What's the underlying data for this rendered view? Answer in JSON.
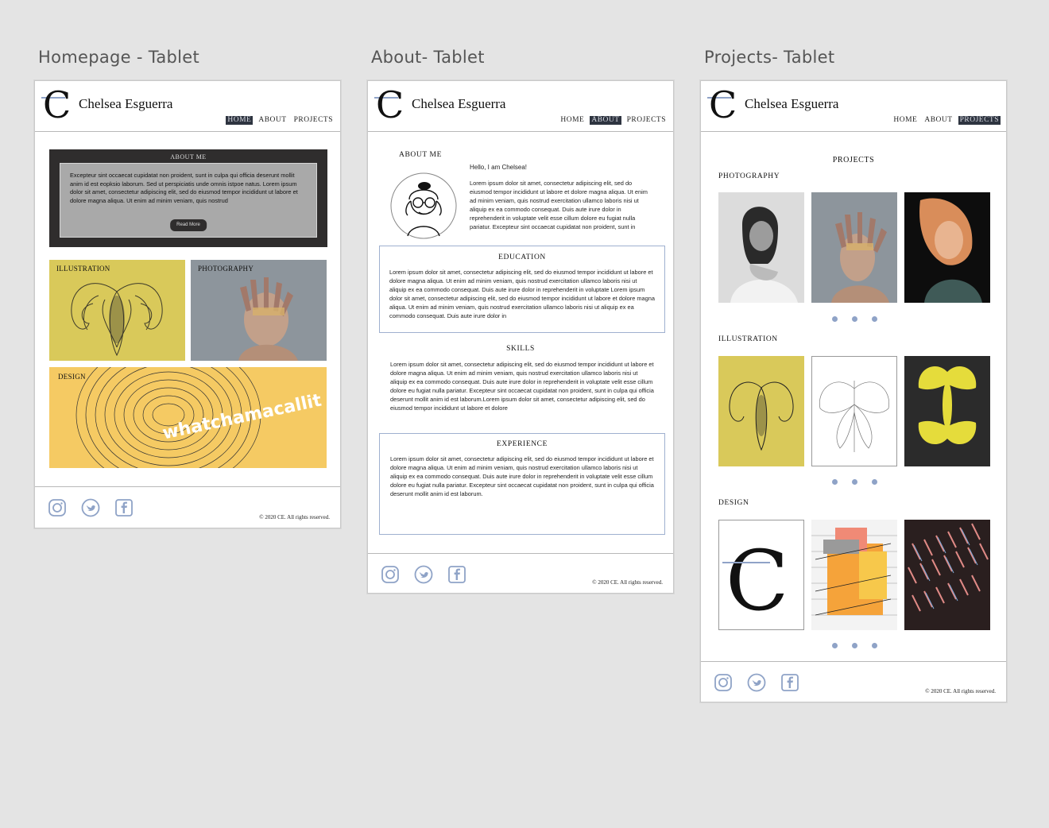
{
  "artboards": {
    "home": "Homepage - Tablet",
    "about": "About- Tablet",
    "projects": "Projects- Tablet"
  },
  "brand": {
    "logo_letter": "C",
    "name": "Chelsea Esguerra"
  },
  "nav": {
    "home": "HOME",
    "about": "ABOUT",
    "projects": "PROJECTS"
  },
  "footer": {
    "copyright": "© 2020 CE. All rights reserved.",
    "icons": [
      "instagram-icon",
      "twitter-icon",
      "facebook-icon"
    ]
  },
  "home": {
    "about_title": "ABOUT ME",
    "about_text": "Excepteur sint occaecat cupidatat non proident, sunt in culpa qui officia deserunt mollit anim id est eopksio laborum. Sed ut perspiciatis unde omnis istpoe natus. Lorem ipsum dolor sit amet, consectetur adipiscing elit, sed do eiusmod tempor incididunt ut labore et dolore magna aliqua. Ut enim ad minim veniam, quis nostrud",
    "read_more": "Read More",
    "tiles": {
      "illustration": "ILLUSTRATION",
      "photography": "PHOTOGRAPHY",
      "design": "DESIGN",
      "design_art_text": "whatchamacallit"
    }
  },
  "about": {
    "title": "ABOUT ME",
    "greeting": "Hello, I am Chelsea!",
    "intro": "Lorem ipsum dolor sit amet, consectetur adipiscing elit, sed do eiusmod tempor incididunt ut labore et dolore magna aliqua. Ut enim ad minim veniam, quis nostrud exercitation ullamco laboris nisi ut aliquip ex ea commodo consequat. Duis aute irure dolor in reprehenderit in voluptate velit esse cillum dolore eu fugiat nulla pariatur. Excepteur sint occaecat cupidatat non proident, sunt in",
    "education_title": "EDUCATION",
    "education": "Lorem ipsum dolor sit amet, consectetur adipiscing elit, sed do eiusmod tempor incididunt ut labore et dolore magna aliqua. Ut enim ad minim veniam, quis nostrud exercitation ullamco laboris nisi ut aliquip ex ea commodo consequat. Duis aute irure dolor in reprehenderit in voluptate Lorem ipsum dolor sit amet, consectetur adipiscing elit, sed do eiusmod tempor incididunt ut labore et dolore magna aliqua. Ut enim ad minim veniam, quis nostrud exercitation ullamco laboris nisi ut aliquip ex ea commodo consequat. Duis aute irure dolor in",
    "skills_title": "SKILLS",
    "skills": "Lorem ipsum dolor sit amet, consectetur adipiscing elit, sed do eiusmod tempor incididunt ut labore et dolore magna aliqua. Ut enim ad minim veniam, quis nostrud exercitation ullamco laboris nisi ut aliquip ex ea commodo consequat. Duis aute irure dolor in reprehenderit in voluptate velit esse cillum dolore eu fugiat nulla pariatur. Excepteur sint occaecat cupidatat non proident, sunt in culpa qui officia deserunt mollit anim id est laborum.Lorem ipsum dolor sit amet, consectetur adipiscing elit, sed do eiusmod tempor incididunt ut labore et dolore",
    "experience_title": "EXPERIENCE",
    "experience": "Lorem ipsum dolor sit amet, consectetur adipiscing elit, sed do eiusmod tempor incididunt ut labore et dolore magna aliqua. Ut enim ad minim veniam, quis nostrud exercitation ullamco laboris nisi ut aliquip ex ea commodo consequat. Duis aute irure dolor in reprehenderit in voluptate velit esse cillum dolore eu fugiat nulla pariatur. Excepteur sint occaecat cupidatat non proident, sunt in culpa qui officia deserunt mollit anim id est laborum."
  },
  "projects": {
    "title": "PROJECTS",
    "photography": "PHOTOGRAPHY",
    "illustration": "ILLUSTRATION",
    "design": "DESIGN"
  },
  "colors": {
    "accent": "#8fa3c7",
    "nav_active": "#2e3440",
    "yellow": "#d9c95a",
    "design_yellow": "#f5ca63"
  }
}
